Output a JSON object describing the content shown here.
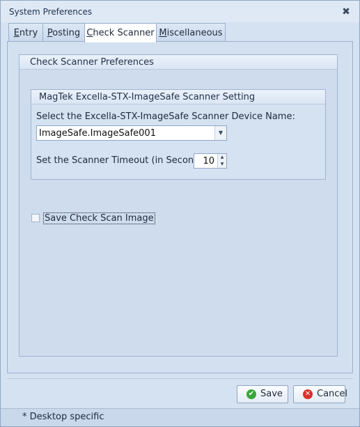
{
  "window": {
    "title": "System Preferences",
    "close_glyph": "✖"
  },
  "tabs": [
    {
      "label": "Entry",
      "mnemonic": "E",
      "rest": "ntry"
    },
    {
      "label": "Posting",
      "mnemonic": "P",
      "rest": "osting"
    },
    {
      "label": "Check Scanner",
      "mnemonic": "C",
      "rest": "heck Scanner",
      "active": true
    },
    {
      "label": "Miscellaneous",
      "mnemonic": "M",
      "rest": "iscellaneous"
    }
  ],
  "check_scanner": {
    "group_title": "Check Scanner Preferences",
    "scanner_group": {
      "title": "MagTek Excella-STX-ImageSafe Scanner Setting",
      "device_label": "Select the Excella-STX-ImageSafe Scanner Device Name:",
      "device_value": "ImageSafe.ImageSafe001",
      "timeout_label": "Set the Scanner Timeout (in Seconds):",
      "timeout_value": "10"
    },
    "save_image_label": "Save Check Scan Image",
    "save_image_checked": false
  },
  "buttons": {
    "save": "Save",
    "cancel": "Cancel"
  },
  "status": {
    "text": "* Desktop specific"
  },
  "colors": {
    "save_icon": "#3aa53a",
    "cancel_icon": "#d9302a"
  }
}
